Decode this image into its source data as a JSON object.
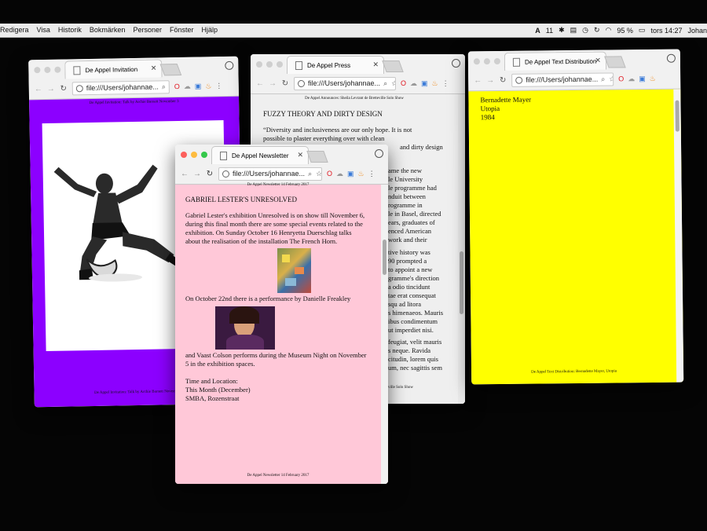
{
  "menubar": {
    "items": [
      "Redigera",
      "Visa",
      "Historik",
      "Bokmärken",
      "Personer",
      "Fönster",
      "Hjälp"
    ],
    "adobe_count": "11",
    "battery": "95 %",
    "clock": "tors 14:27",
    "user": "Johan"
  },
  "url": "file:///Users/johannae...",
  "win1": {
    "tab": "De Appel Invitation",
    "header": "De Appel Invitation: Talk by Archie Barnett November 3",
    "footer": "De Appel Invitation: Talk by Archie Barnett November 3",
    "bg": "#8c00ff"
  },
  "win2": {
    "tab": "De Appel Press",
    "header": "De Appel Announces: Sheila Levrant de Bretteville Solo Show",
    "title": "FUZZY THEORY AND DIRTY DESIGN",
    "p1": "“Diversity and inclusiveness are our only hope. It is not possible to plaster everything over with clean",
    "p1_tail": "and dirty design",
    "lines_a": [
      "ame the new",
      "le University",
      "le programme had",
      "nduit between",
      "rogramme in",
      "le in Basel, directed",
      "ears, graduates of",
      "enced American",
      "work and their"
    ],
    "lines_b": [
      "tive history was",
      "90 prompted a",
      "to appoint a new",
      "gramme's direction",
      "a odio tincidunt",
      "tae erat consequat",
      "squ ad litora",
      "s himenaeos. Mauris",
      "ibus condimentum",
      "ut imperdiet nisi."
    ],
    "lines_c": [
      "feugiat, velit mauris",
      "s neque. Ravida",
      "citudin, lorem quis",
      "um, nec sagittis sem"
    ],
    "footer": "ville Solo Show"
  },
  "win3": {
    "tab": "De Appel Text Distribution",
    "lines": [
      "Bernadette Mayer",
      "Utopia",
      "1984"
    ],
    "footer": "De Appel Text Distribution: Bernadette Mayer, Utopia",
    "bg": "#ffff00"
  },
  "win4": {
    "tab": "De Appel Newsletter",
    "header": "De Appel Newsletter 14 February 2017",
    "title": "GABRIEL LESTER'S UNRESOLVED",
    "p1": "Gabriel Lester's exhibition Unresolved is on show till November 6, during this final month there are some special events related to the exhibition. On Sunday October 16 Henryetta Duerschlag talks about the realisation of the installation The French Horn.",
    "p2": "On October 22nd there is a performance by Danielle Freakley",
    "p3": "and Vaast Colson performs during the Museum Night on November 5 in the exhibition spaces.",
    "time_label": "Time and Location:",
    "time": "This Month (December)",
    "location": "SMBA, Rozenstraat",
    "footer": "De Appel Newsletter 14 February 2017",
    "bg": "#ffc8d8"
  }
}
